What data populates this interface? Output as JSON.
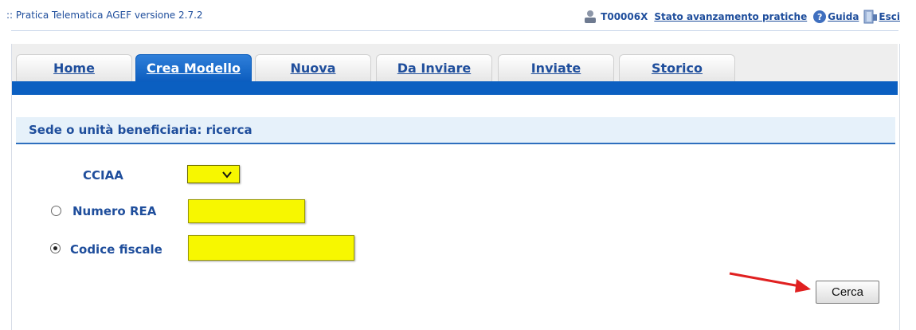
{
  "header": {
    "app_title": ":: Pratica Telematica AGEF versione 2.7.2",
    "user_id": "T00006X",
    "links": {
      "stato": "Stato avanzamento pratiche",
      "guida": "Guida",
      "esci": "Esci"
    }
  },
  "tabs": [
    {
      "label": "Home",
      "active": false
    },
    {
      "label": "Crea Modello",
      "active": true
    },
    {
      "label": "Nuova",
      "active": false
    },
    {
      "label": "Da Inviare",
      "active": false
    },
    {
      "label": "Inviate",
      "active": false
    },
    {
      "label": "Storico",
      "active": false
    }
  ],
  "section": {
    "title": "Sede o unità beneficiaria: ricerca"
  },
  "form": {
    "cciaa_label": "CCIAA",
    "cciaa_value": "",
    "numero_rea_label": "Numero REA",
    "numero_rea_value": "",
    "codice_fiscale_label": "Codice fiscale",
    "codice_fiscale_value": "",
    "selected_option": "codice_fiscale",
    "search_button": "Cerca"
  },
  "colors": {
    "accent_blue": "#0b5fc1",
    "link_blue": "#1f4e9c",
    "field_yellow": "#f7f700",
    "annotation_red": "#e02020"
  },
  "icons": [
    "user-icon",
    "help-icon",
    "exit-icon",
    "chevron-down-icon",
    "red-arrow-icon"
  ]
}
